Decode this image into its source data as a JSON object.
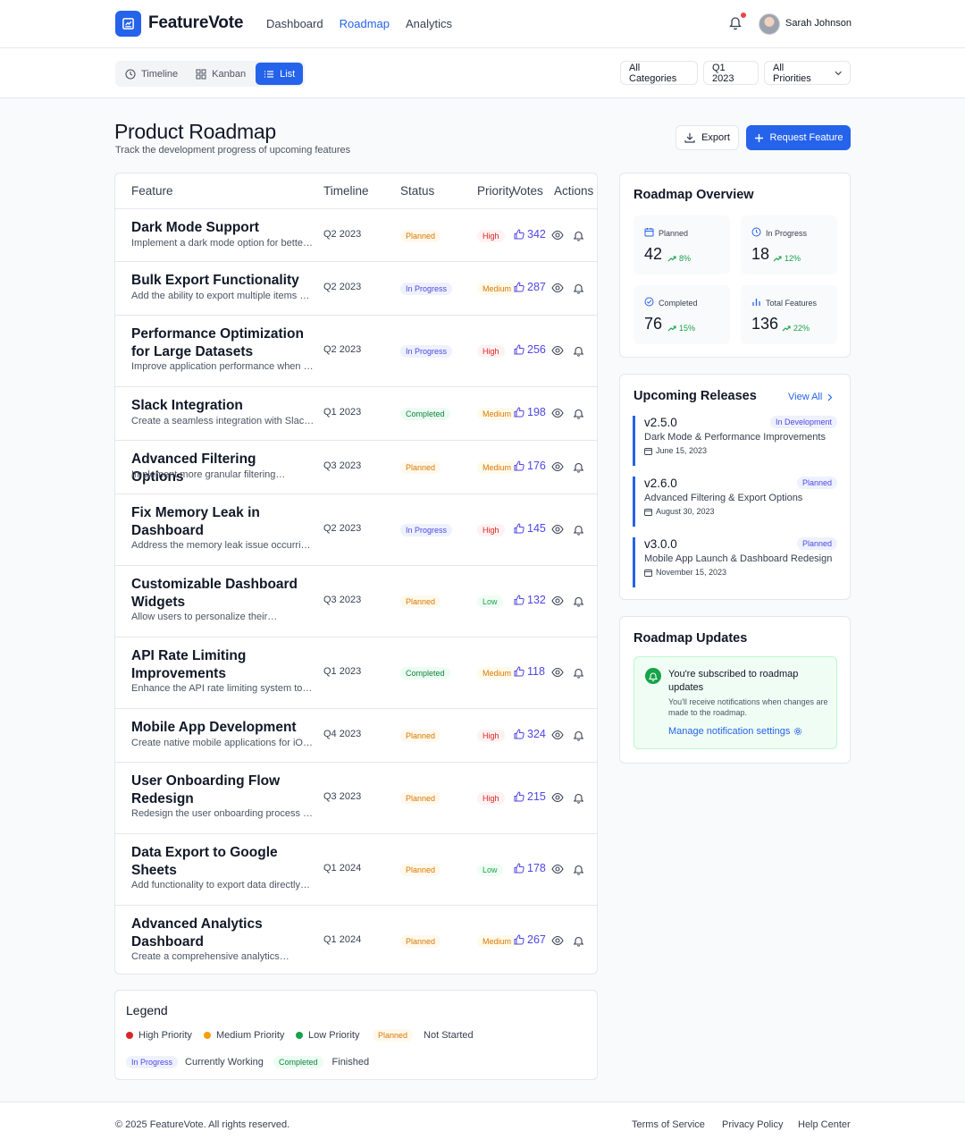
{
  "app": {
    "name": "FeatureVote"
  },
  "nav": {
    "items": [
      "Dashboard",
      "Roadmap",
      "Analytics"
    ],
    "active": "Roadmap"
  },
  "user": {
    "name": "Sarah Johnson"
  },
  "views": {
    "timeline": "Timeline",
    "kanban": "Kanban",
    "list": "List"
  },
  "filters": {
    "category": "All Categories",
    "quarter": "Q1 2023",
    "priority": "All Priorities"
  },
  "page": {
    "title": "Product Roadmap",
    "subtitle": "Track the development progress of upcoming features"
  },
  "actions": {
    "export": "Export",
    "request": "Request Feature"
  },
  "table": {
    "headers": {
      "feature": "Feature",
      "timeline": "Timeline",
      "status": "Status",
      "priority": "Priority",
      "votes": "Votes",
      "actions": "Actions"
    },
    "rows": [
      {
        "name": "Dark Mode Support",
        "desc": "Implement a dark mode option for better user experience",
        "timeline": "Q2 2023",
        "status": "Planned",
        "priority": "High",
        "votes": "342"
      },
      {
        "name": "Bulk Export Functionality",
        "desc": "Add the ability to export multiple items at once",
        "timeline": "Q2 2023",
        "status": "In Progress",
        "priority": "Medium",
        "votes": "287"
      },
      {
        "name": "Performance Optimization for Large Datasets",
        "desc": "Improve application performance when handling large datasets",
        "timeline": "Q2 2023",
        "status": "In Progress",
        "priority": "High",
        "votes": "256"
      },
      {
        "name": "Slack Integration",
        "desc": "Create a seamless integration with Slack for notifications",
        "timeline": "Q1 2023",
        "status": "Completed",
        "priority": "Medium",
        "votes": "198"
      },
      {
        "name": "Advanced Filtering Options",
        "desc": "Implement more granular filtering…",
        "timeline": "Q3 2023",
        "status": "Planned",
        "priority": "Medium",
        "votes": "176"
      },
      {
        "name": "Fix Memory Leak in Dashboard",
        "desc": "Address the memory leak issue occurring in the dashboard",
        "timeline": "Q2 2023",
        "status": "In Progress",
        "priority": "High",
        "votes": "145"
      },
      {
        "name": "Customizable Dashboard Widgets",
        "desc": "Allow users to personalize their…",
        "timeline": "Q3 2023",
        "status": "Planned",
        "priority": "Low",
        "votes": "132"
      },
      {
        "name": "API Rate Limiting Improvements",
        "desc": "Enhance the API rate limiting system to handle load",
        "timeline": "Q1 2023",
        "status": "Completed",
        "priority": "Medium",
        "votes": "118"
      },
      {
        "name": "Mobile App Development",
        "desc": "Create native mobile applications for iOS and Android",
        "timeline": "Q4 2023",
        "status": "Planned",
        "priority": "High",
        "votes": "324"
      },
      {
        "name": "User Onboarding Flow Redesign",
        "desc": "Redesign the user onboarding process to improve activation",
        "timeline": "Q3 2023",
        "status": "Planned",
        "priority": "High",
        "votes": "215"
      },
      {
        "name": "Data Export to Google Sheets",
        "desc": "Add functionality to export data directly…",
        "timeline": "Q1 2024",
        "status": "Planned",
        "priority": "Low",
        "votes": "178"
      },
      {
        "name": "Advanced Analytics Dashboard",
        "desc": "Create a comprehensive analytics…",
        "timeline": "Q1 2024",
        "status": "Planned",
        "priority": "Medium",
        "votes": "267"
      }
    ]
  },
  "overview": {
    "title": "Roadmap Overview",
    "stats": [
      {
        "label": "Planned",
        "value": "42",
        "change": "8%",
        "icon": "calendar-icon"
      },
      {
        "label": "In Progress",
        "value": "18",
        "change": "12%",
        "icon": "clock-icon"
      },
      {
        "label": "Completed",
        "value": "76",
        "change": "15%",
        "icon": "check-circle-icon"
      },
      {
        "label": "Total Features",
        "value": "136",
        "change": "22%",
        "icon": "bar-chart-icon"
      }
    ]
  },
  "releases": {
    "title": "Upcoming Releases",
    "view_all": "View All",
    "items": [
      {
        "version": "v2.5.0",
        "badge": "In Development",
        "desc": "Dark Mode & Performance Improvements",
        "date": "June 15, 2023"
      },
      {
        "version": "v2.6.0",
        "badge": "Planned",
        "desc": "Advanced Filtering & Export Options",
        "date": "August 30, 2023"
      },
      {
        "version": "v3.0.0",
        "badge": "Planned",
        "desc": "Mobile App Launch & Dashboard Redesign",
        "date": "November 15, 2023"
      }
    ]
  },
  "updates": {
    "title": "Roadmap Updates",
    "heading": "You're subscribed to roadmap updates",
    "body": "You'll receive notifications when changes are made to the roadmap.",
    "link": "Manage notification settings"
  },
  "legend": {
    "title": "Legend",
    "high": "High Priority",
    "medium": "Medium Priority",
    "low": "Low Priority",
    "planned_badge": "Planned",
    "planned_text": "Not Started",
    "inprog_badge": "In Progress",
    "inprog_text": "Currently Working",
    "completed_badge": "Completed",
    "completed_text": "Finished"
  },
  "footer": {
    "copyright": "© 2025 FeatureVote. All rights reserved.",
    "links": [
      "Terms of Service",
      "Privacy Policy",
      "Help Center"
    ]
  },
  "colors": {
    "accent": "#2563eb",
    "high": "#dc2626",
    "medium": "#f59e0b",
    "low": "#16a34a"
  }
}
